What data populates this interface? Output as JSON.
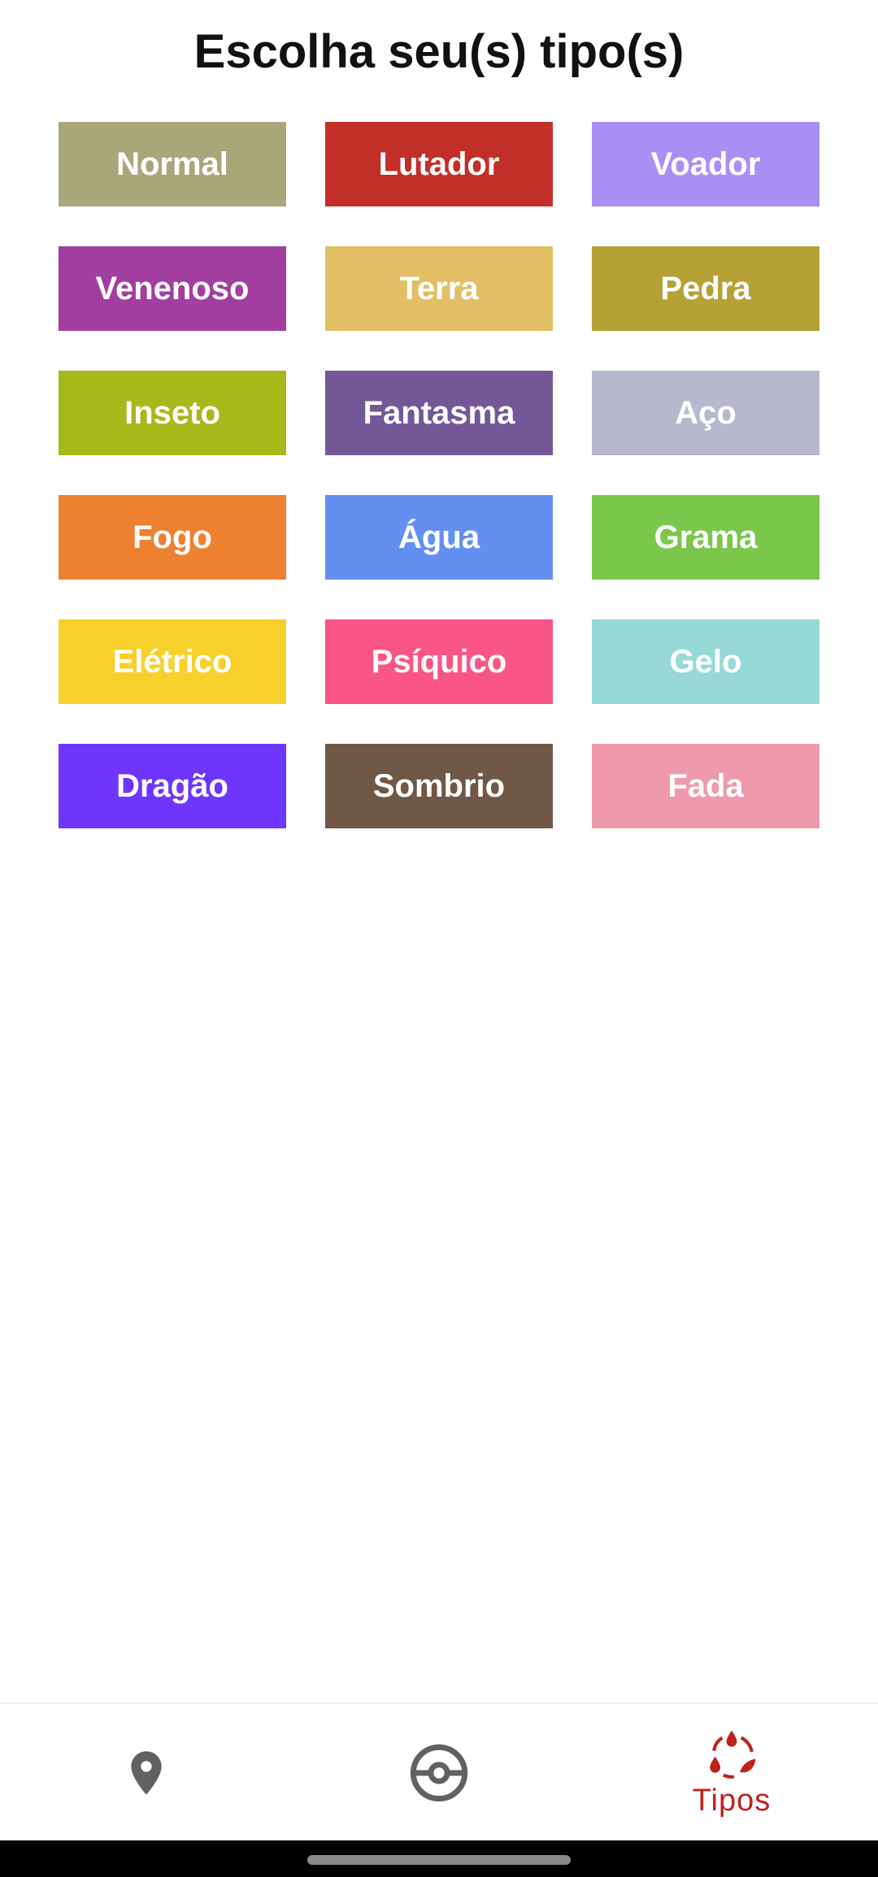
{
  "header": {
    "title": "Escolha seu(s) tipo(s)"
  },
  "types": [
    {
      "label": "Normal",
      "color": "#A8A77A"
    },
    {
      "label": "Lutador",
      "color": "#C22E28"
    },
    {
      "label": "Voador",
      "color": "#A98FF3"
    },
    {
      "label": "Venenoso",
      "color": "#A33EA1"
    },
    {
      "label": "Terra",
      "color": "#E2BF65"
    },
    {
      "label": "Pedra",
      "color": "#B6A136"
    },
    {
      "label": "Inseto",
      "color": "#A6B91A"
    },
    {
      "label": "Fantasma",
      "color": "#735797"
    },
    {
      "label": "Aço",
      "color": "#B7B7CE"
    },
    {
      "label": "Fogo",
      "color": "#EE8130"
    },
    {
      "label": "Água",
      "color": "#6390F0"
    },
    {
      "label": "Grama",
      "color": "#7AC74C"
    },
    {
      "label": "Elétrico",
      "color": "#F7D02C"
    },
    {
      "label": "Psíquico",
      "color": "#F95587"
    },
    {
      "label": "Gelo",
      "color": "#96D9D6"
    },
    {
      "label": "Dragão",
      "color": "#6F35FC"
    },
    {
      "label": "Sombrio",
      "color": "#705746"
    },
    {
      "label": "Fada",
      "color": "#EE99AC"
    }
  ],
  "bottom_nav": {
    "items": [
      {
        "icon": "location-pin-icon",
        "label": ""
      },
      {
        "icon": "pokeball-icon",
        "label": ""
      },
      {
        "icon": "types-icon",
        "label": "Tipos",
        "active": true
      }
    ],
    "active_color": "#C0211C",
    "inactive_color": "#616161"
  }
}
